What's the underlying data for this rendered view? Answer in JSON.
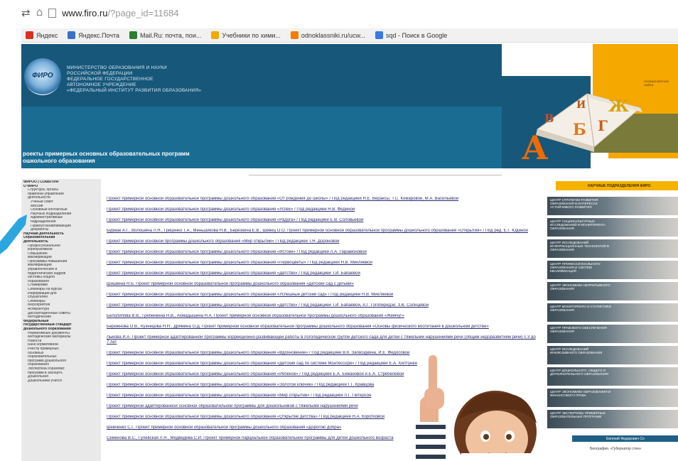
{
  "browser": {
    "nav_glyph": "⇄",
    "home_glyph": "⌂",
    "url_domain": "www.firo.ru",
    "url_path": "/?page_id=11684",
    "bookmarks": [
      {
        "label": "Яндекс",
        "color": "#d93025"
      },
      {
        "label": "Яндекс.Почта",
        "color": "#3b6fc4"
      },
      {
        "label": "Mail.Ru: почта, пои...",
        "color": "#2e7d32"
      },
      {
        "label": "Учебники по хими...",
        "color": "#f5a800"
      },
      {
        "label": "odnoklassniki.ru/ucw...",
        "color": "#f57c00"
      },
      {
        "label": "sqd - Поиск в Google",
        "color": "#3b78e7"
      }
    ]
  },
  "header": {
    "logo_text": "ФИРО",
    "ministry_lines": [
      "МИНИСТЕРСТВО ОБРАЗОВАНИЯ И НАУКИ",
      "РОССИЙСКОЙ ФЕДЕРАЦИИ",
      "ФЕДЕРАЛЬНОЕ ГОСУДАРСТВЕННОЕ",
      "АВТОНОМНОЕ УЧРЕЖДЕНИЕ",
      "«ФЕДЕРАЛЬНЫЙ ИНСТИТУТ РАЗВИТИЯ ОБРАЗОВАНИЯ»"
    ],
    "subtitle_line1": "роекты примерных основных образовательных программ",
    "subtitle_line2": "ошкольного образования",
    "right_tiny_text": "ПОЛНАЯ ВЕРСИЯ САЙТА",
    "book_letters": [
      "А",
      "Б",
      "В",
      "Г",
      "Ж",
      "И"
    ],
    "colors": {
      "navy": "#17577a",
      "blue": "#1a6c93",
      "orange": "#f5a800",
      "olive": "#7a7a3a"
    }
  },
  "left_menu": [
    {
      "label": "ФИРОО | СОБЫТИЯ",
      "level": 0
    },
    {
      "label": "О ФИРО",
      "level": 0
    },
    {
      "label": "Структура, органы",
      "level": 1
    },
    {
      "label": "правлени управления",
      "level": 1
    },
    {
      "label": "деятельности",
      "level": 1
    },
    {
      "label": "Ученый совет",
      "level": 2
    },
    {
      "label": "Миссия",
      "level": 2
    },
    {
      "label": "Основные контактные",
      "level": 2
    },
    {
      "label": "Научных подразделений",
      "level": 2
    },
    {
      "label": "Административные",
      "level": 2
    },
    {
      "label": "подразделения",
      "level": 2
    },
    {
      "label": "Правоустанавливающие",
      "level": 2
    },
    {
      "label": "документы",
      "level": 2
    },
    {
      "label": "Научная деятельность",
      "level": 0
    },
    {
      "label": "Образовательная",
      "level": 0
    },
    {
      "label": "деятельность",
      "level": 0
    },
    {
      "label": "Профессиональное",
      "level": 1
    },
    {
      "label": "корпоративное",
      "level": 1
    },
    {
      "label": "Повышение",
      "level": 1
    },
    {
      "label": "квалификации",
      "level": 1
    },
    {
      "label": "Программы повышения",
      "level": 1
    },
    {
      "label": "квалификации",
      "level": 1
    },
    {
      "label": "управленческих и",
      "level": 1
    },
    {
      "label": "педагогических кадров",
      "level": 1
    },
    {
      "label": "системы общего",
      "level": 1
    },
    {
      "label": "образования",
      "level": 1
    },
    {
      "label": "Стажировки",
      "level": 1
    },
    {
      "label": "Семинары на курсах",
      "level": 1
    },
    {
      "label": "Информация для",
      "level": 1
    },
    {
      "label": "слушателей",
      "level": 1
    },
    {
      "label": "Семинары",
      "level": 1
    },
    {
      "label": "Мероприятия",
      "level": 1
    },
    {
      "label": "Аспирантура",
      "level": 1
    },
    {
      "label": "Диссертационные советы",
      "level": 1
    },
    {
      "label": "Методические",
      "level": 1
    },
    {
      "label": "Федеральный",
      "level": 0
    },
    {
      "label": "государственный стандарт",
      "level": 0
    },
    {
      "label": "дошкольного образования",
      "level": 0
    },
    {
      "label": "Нормативные документы",
      "level": 1
    },
    {
      "label": "Методические материалы",
      "level": 1
    },
    {
      "label": "Новости",
      "level": 1
    },
    {
      "label": "Банк нормативной",
      "level": 1
    },
    {
      "label": "Реестр примерных",
      "level": 1
    },
    {
      "label": "основных",
      "level": 1
    },
    {
      "label": "образовательных",
      "level": 1
    },
    {
      "label": "программ дошкольного",
      "level": 1
    },
    {
      "label": "образования",
      "level": 1
    },
    {
      "label": "Экспертиза образоват.",
      "level": 1
    },
    {
      "label": "программ в экспертн.",
      "level": 1
    },
    {
      "label": "Дошкольная",
      "level": 1
    },
    {
      "label": "Дошкольники учатся",
      "level": 1
    }
  ],
  "links": [
    "Проект примерной основной образовательной программы дошкольного образования «От рождения до школы» / Под редакцией Н.Е. Вераксы, Т.С. Комаровой, М.А. Васильевой",
    "Проект примерной основной образовательной программы дошкольного образования «Успех» / Под редакцией Н.В. Фединой",
    "Проект примерной основной образовательной программы дошкольного образования «Радуга» / Под редакцией Е.В. Соловьёвой",
    "Бурмак А.Г., Волошина Л.Н., Гриценко Т.А., Меньшикова Н.В., Берёзкина Е.В., Шевец О.О. Проект примерной основной образовательной программы дошкольного образования «Открытия» / Под ред. Е.Г. Юдиной",
    "Проект примерной основной программы дошкольного образования «Мир открытий» / Под редакцией Т.Н. Дороновой",
    "Проект примерной основной образовательной программы дошкольного образования «Истоки» / Под редакцией Л.А. Парамоновой",
    "Проект примерной основной образовательной программы дошкольного образования «Первоцветы» / Под редакцией Н.В. Микляевой",
    "Проект примерной основной образовательной программы дошкольного образования «Детство» / Под редакцией Т.И. Бабаевой",
    "Шишкина Н.Б. Проект примерной основной образовательной программы дошкольного образования «Детский сад с детьми»",
    "Проект примерной основной образовательной программы дошкольного образования «Успешный детский сад» / Под редакцией Н.В. Микляевой",
    "Проект примерной основной образовательной программы дошкольного образования «Детство» / Под редакцией Т.И. Бабаевой, А.Г. Гогоберидзе, З.В. Солнцевой",
    "Белолипова В.В., Гребенкина Н.В., Ахмадышина Н.А. Проект примерной основной образовательной программы дошкольного образования «Жемчуг»",
    "Бережнова О.В., Кузнецова Н.Н., Дрямина О.Д. Проект примерной основной образовательной программы дошкольного образования «Основы физического воспитания в дошкольном детстве»",
    "Лыкова И.А. Проект примерной адаптированной программы коррекционно-развивающей работы в логопедической группе детского сада для детей с тяжелыми нарушениями речи (общим недоразвитием речи) с 3 до 7 лет",
    "Проект примерной основной образовательной программы дошкольного образования «Вдохновение» / Под редакцией В.К. Загвоздкина, И.Е. Федосовой",
    "Проект примерной основной образовательной программы дошкольного образования «Детский сад по системе Монтессори» / Под редакцией Е.А. Хилтунен",
    "Проект примерной основной образовательной программы дошкольного образования «Ребенок» / Под редакцией Е.А. Екжановой и Е.А. Стребелевой",
    "Проект примерной основной образовательной программы дошкольного образования «Золотой ключик» / Под редакцией Г.Г. Кравцова",
    "Проект примерной основной образовательной программы дошкольного образования «Мир открытий» / Под редакцией Л.Г. Петерсон",
    "Проект примерной адаптированной основной образовательной программы для дошкольников с тяжелыми нарушениями речи",
    "Проект примерной основной образовательной программы дошкольного образования «Открытие детства» / Под редакцией Н.А. Коротковой",
    "Шевченко С.Г. Проект примерной основной образовательной программы дошкольного образования «Дорогою добра»",
    "Семенова В.С., Гулевская Л.Н., Медведева С.И. Проект примерной парциальной образовательной программы для детей дошкольного возраста"
  ],
  "right_sidebar": {
    "header": "НАУЧНЫЕ ПОДРАЗДЕЛЕНИЯ ФИРО",
    "items": [
      "ЦЕНТР СТРАТЕГИИ РАЗВИТИЯ ОБРАЗОВАНИЯ В ИНТЕРЕСАХ УСТОЙЧИВОГО РАЗВИТИЯ",
      "ЦЕНТР СОЦИОКУЛЬТУРНЫХ ИССЛЕДОВАНИЙ И МОНИТОРИНГА ОБРАЗОВАНИЯ",
      "ЦЕНТР ИССЛЕДОВАНИЙ ИНФОРМАЦИОННЫХ ТЕХНОЛОГИЙ В ОБРАЗОВАНИИ",
      "ЦЕНТР ПРОФЕССИОНАЛЬНОГО ОБРАЗОВАНИЯ И СИСТЕМ КВАЛИФИКАЦИЙ",
      "ЦЕНТР ЭКОНОМИКИ НЕПРЕРЫВНОГО ОБРАЗОВАНИЯ",
      "ЦЕНТР МОНИТОРИНГА И СТАТИСТИКИ ОБРАЗОВАНИЯ",
      "ЦЕНТР ПРАВОВОГО ОБЕСПЕЧЕНИЯ ОБРАЗОВАНИЯ",
      "ЦЕНТР ИССЛЕДОВАНИЙ ИНКЛЮЗИВНОГО ОБРАЗОВАНИЯ",
      "ЦЕНТР ДОШКОЛЬНОГО, ОБЩЕГО И ДОПОЛНИТЕЛЬНОГО ОБРАЗОВАНИЯ",
      "ЦЕНТР ЭКОНОМИКИ ОБРАЗОВАНИЯ И ФИНАНСОВОГО ПРАВА",
      "ЦЕНТР ЭКСПЕРТИЗЫ ПРИМЕРНЫХ ОБРАЗОВАТЕЛЬНЫХ ПРОГРАММ"
    ],
    "bar_label": "Евгений Федорович Со",
    "footer": "Биография. «Губернатор стен»"
  }
}
